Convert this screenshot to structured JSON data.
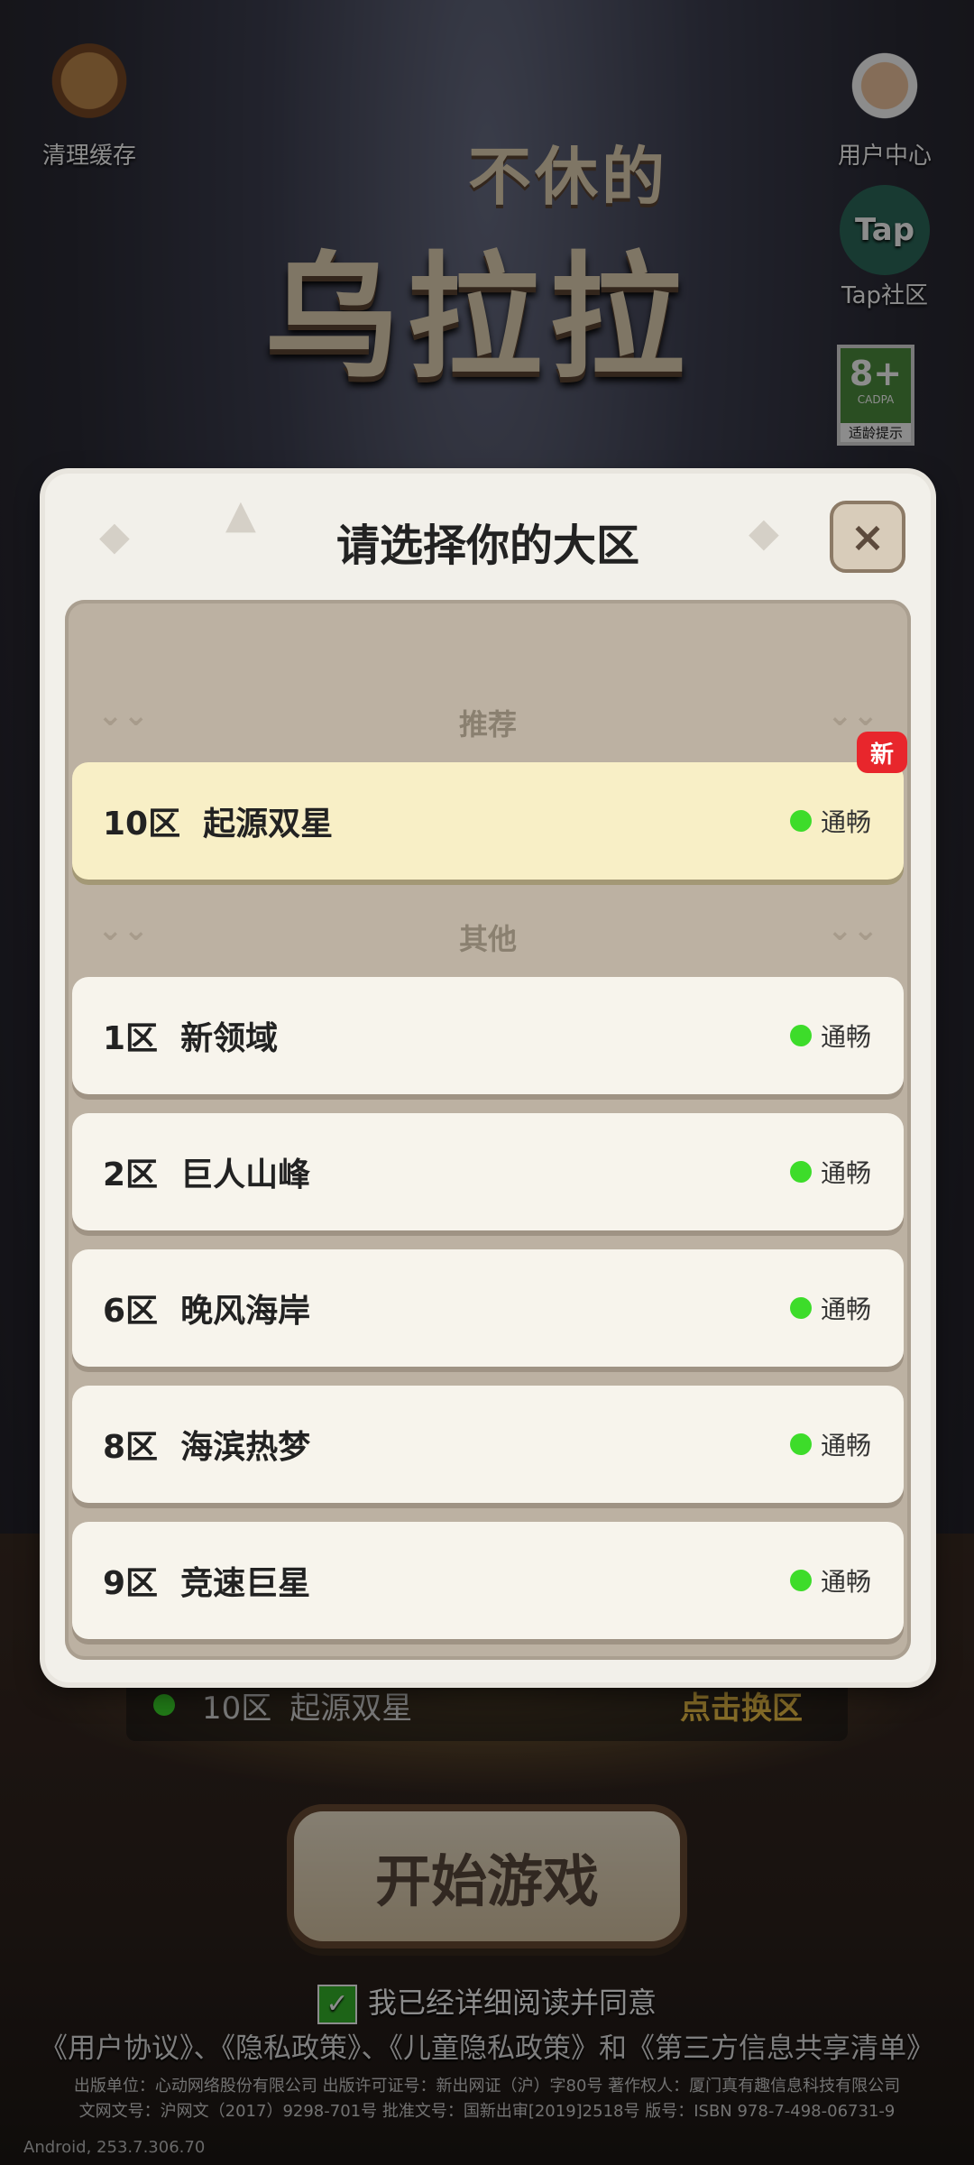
{
  "top_icons": {
    "clean_cache": "清理缓存",
    "user_center": "用户中心",
    "tap_community": "Tap社区",
    "tap_text": "Tap"
  },
  "age_rating": {
    "number": "8+",
    "org": "CADPA",
    "label": "适龄提示"
  },
  "logo": {
    "line1": "不休的",
    "line2": "乌拉拉"
  },
  "modal": {
    "title": "请选择你的大区",
    "close_label": "×",
    "recommended_label": "推荐",
    "other_label": "其他",
    "recommended": [
      {
        "name": "10区  起源双星",
        "status": "通畅",
        "badge": "新"
      }
    ],
    "others": [
      {
        "name": "1区  新领域",
        "status": "通畅"
      },
      {
        "name": "2区  巨人山峰",
        "status": "通畅"
      },
      {
        "name": "6区  晚风海岸",
        "status": "通畅"
      },
      {
        "name": "8区  海滨热梦",
        "status": "通畅"
      },
      {
        "name": "9区  竞速巨星",
        "status": "通畅"
      }
    ]
  },
  "current_server": {
    "zone": "10区",
    "name": "起源双星",
    "switch_label": "点击换区"
  },
  "start_button": "开始游戏",
  "agreement": {
    "text": "我已经详细阅读并同意",
    "links": "《用户协议》、《隐私政策》、《儿童隐私政策》和《第三方信息共享清单》"
  },
  "legal": {
    "line1": "出版单位：心动网络股份有限公司 出版许可证号：新出网证（沪）字80号 著作权人：厦门真有趣信息科技有限公司",
    "line2": "文网文号：沪网文（2017）9298-701号 批准文号：国新出审[2019]2518号 版号：ISBN 978-7-498-06731-9"
  },
  "version": "Android, 253.7.306.70",
  "colors": {
    "status_green": "#3ddc2a",
    "new_badge": "#e8262c",
    "switch_text": "#f3c54a"
  }
}
